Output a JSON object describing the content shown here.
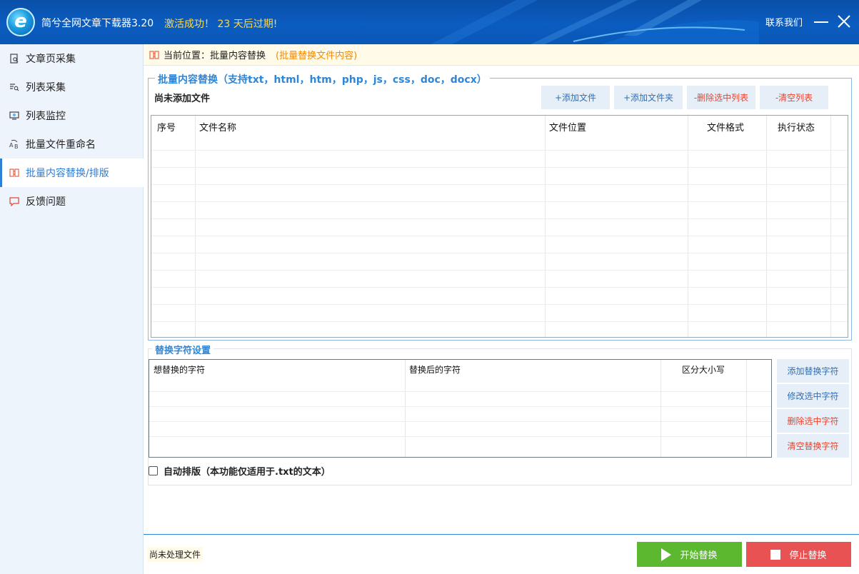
{
  "titlebar": {
    "app_title": "简兮全网文章下载器3.20",
    "activation": "激活成功！ 23 天后过期!",
    "contact": "联系我们"
  },
  "sidebar": {
    "items": [
      {
        "label": "文章页采集",
        "icon": "doc-search-icon"
      },
      {
        "label": "列表采集",
        "icon": "list-search-icon"
      },
      {
        "label": "列表监控",
        "icon": "monitor-icon"
      },
      {
        "label": "批量文件重命名",
        "icon": "rename-icon"
      },
      {
        "label": "批量内容替换/排版",
        "icon": "replace-icon",
        "active": true
      },
      {
        "label": "反馈问题",
        "icon": "chat-icon"
      }
    ]
  },
  "breadcrumb": {
    "prefix": "当前位置：批量内容替换",
    "hint": "(批量替换文件内容)"
  },
  "batch_group": {
    "legend": "批量内容替换（支持txt，html，htm，php，js，css，doc，docx）",
    "status": "尚未添加文件",
    "buttons": {
      "add_file": "+添加文件",
      "add_folder": "+添加文件夹",
      "remove_selected": "-删除选中列表",
      "clear_list": "-清空列表"
    },
    "columns": [
      "序号",
      "文件名称",
      "文件位置",
      "文件格式",
      "执行状态"
    ]
  },
  "replace_group": {
    "legend": "替换字符设置",
    "columns": [
      "想替换的字符",
      "替换后的字符",
      "区分大小写"
    ],
    "buttons": {
      "add": "添加替换字符",
      "edit": "修改选中字符",
      "delete": "删除选中字符",
      "clear": "清空替换字符"
    },
    "auto_format": {
      "label": "自动排版（本功能仅适用于.txt的文本）",
      "checked": false
    }
  },
  "bottom": {
    "status": "尚未处理文件",
    "start": "开始替换",
    "stop": "停止替换"
  },
  "colors": {
    "titlebar": "#0b5cc0",
    "accent": "#2c86d9",
    "start": "#5cb82e",
    "stop": "#e85252",
    "warning": "#f08a0c"
  }
}
